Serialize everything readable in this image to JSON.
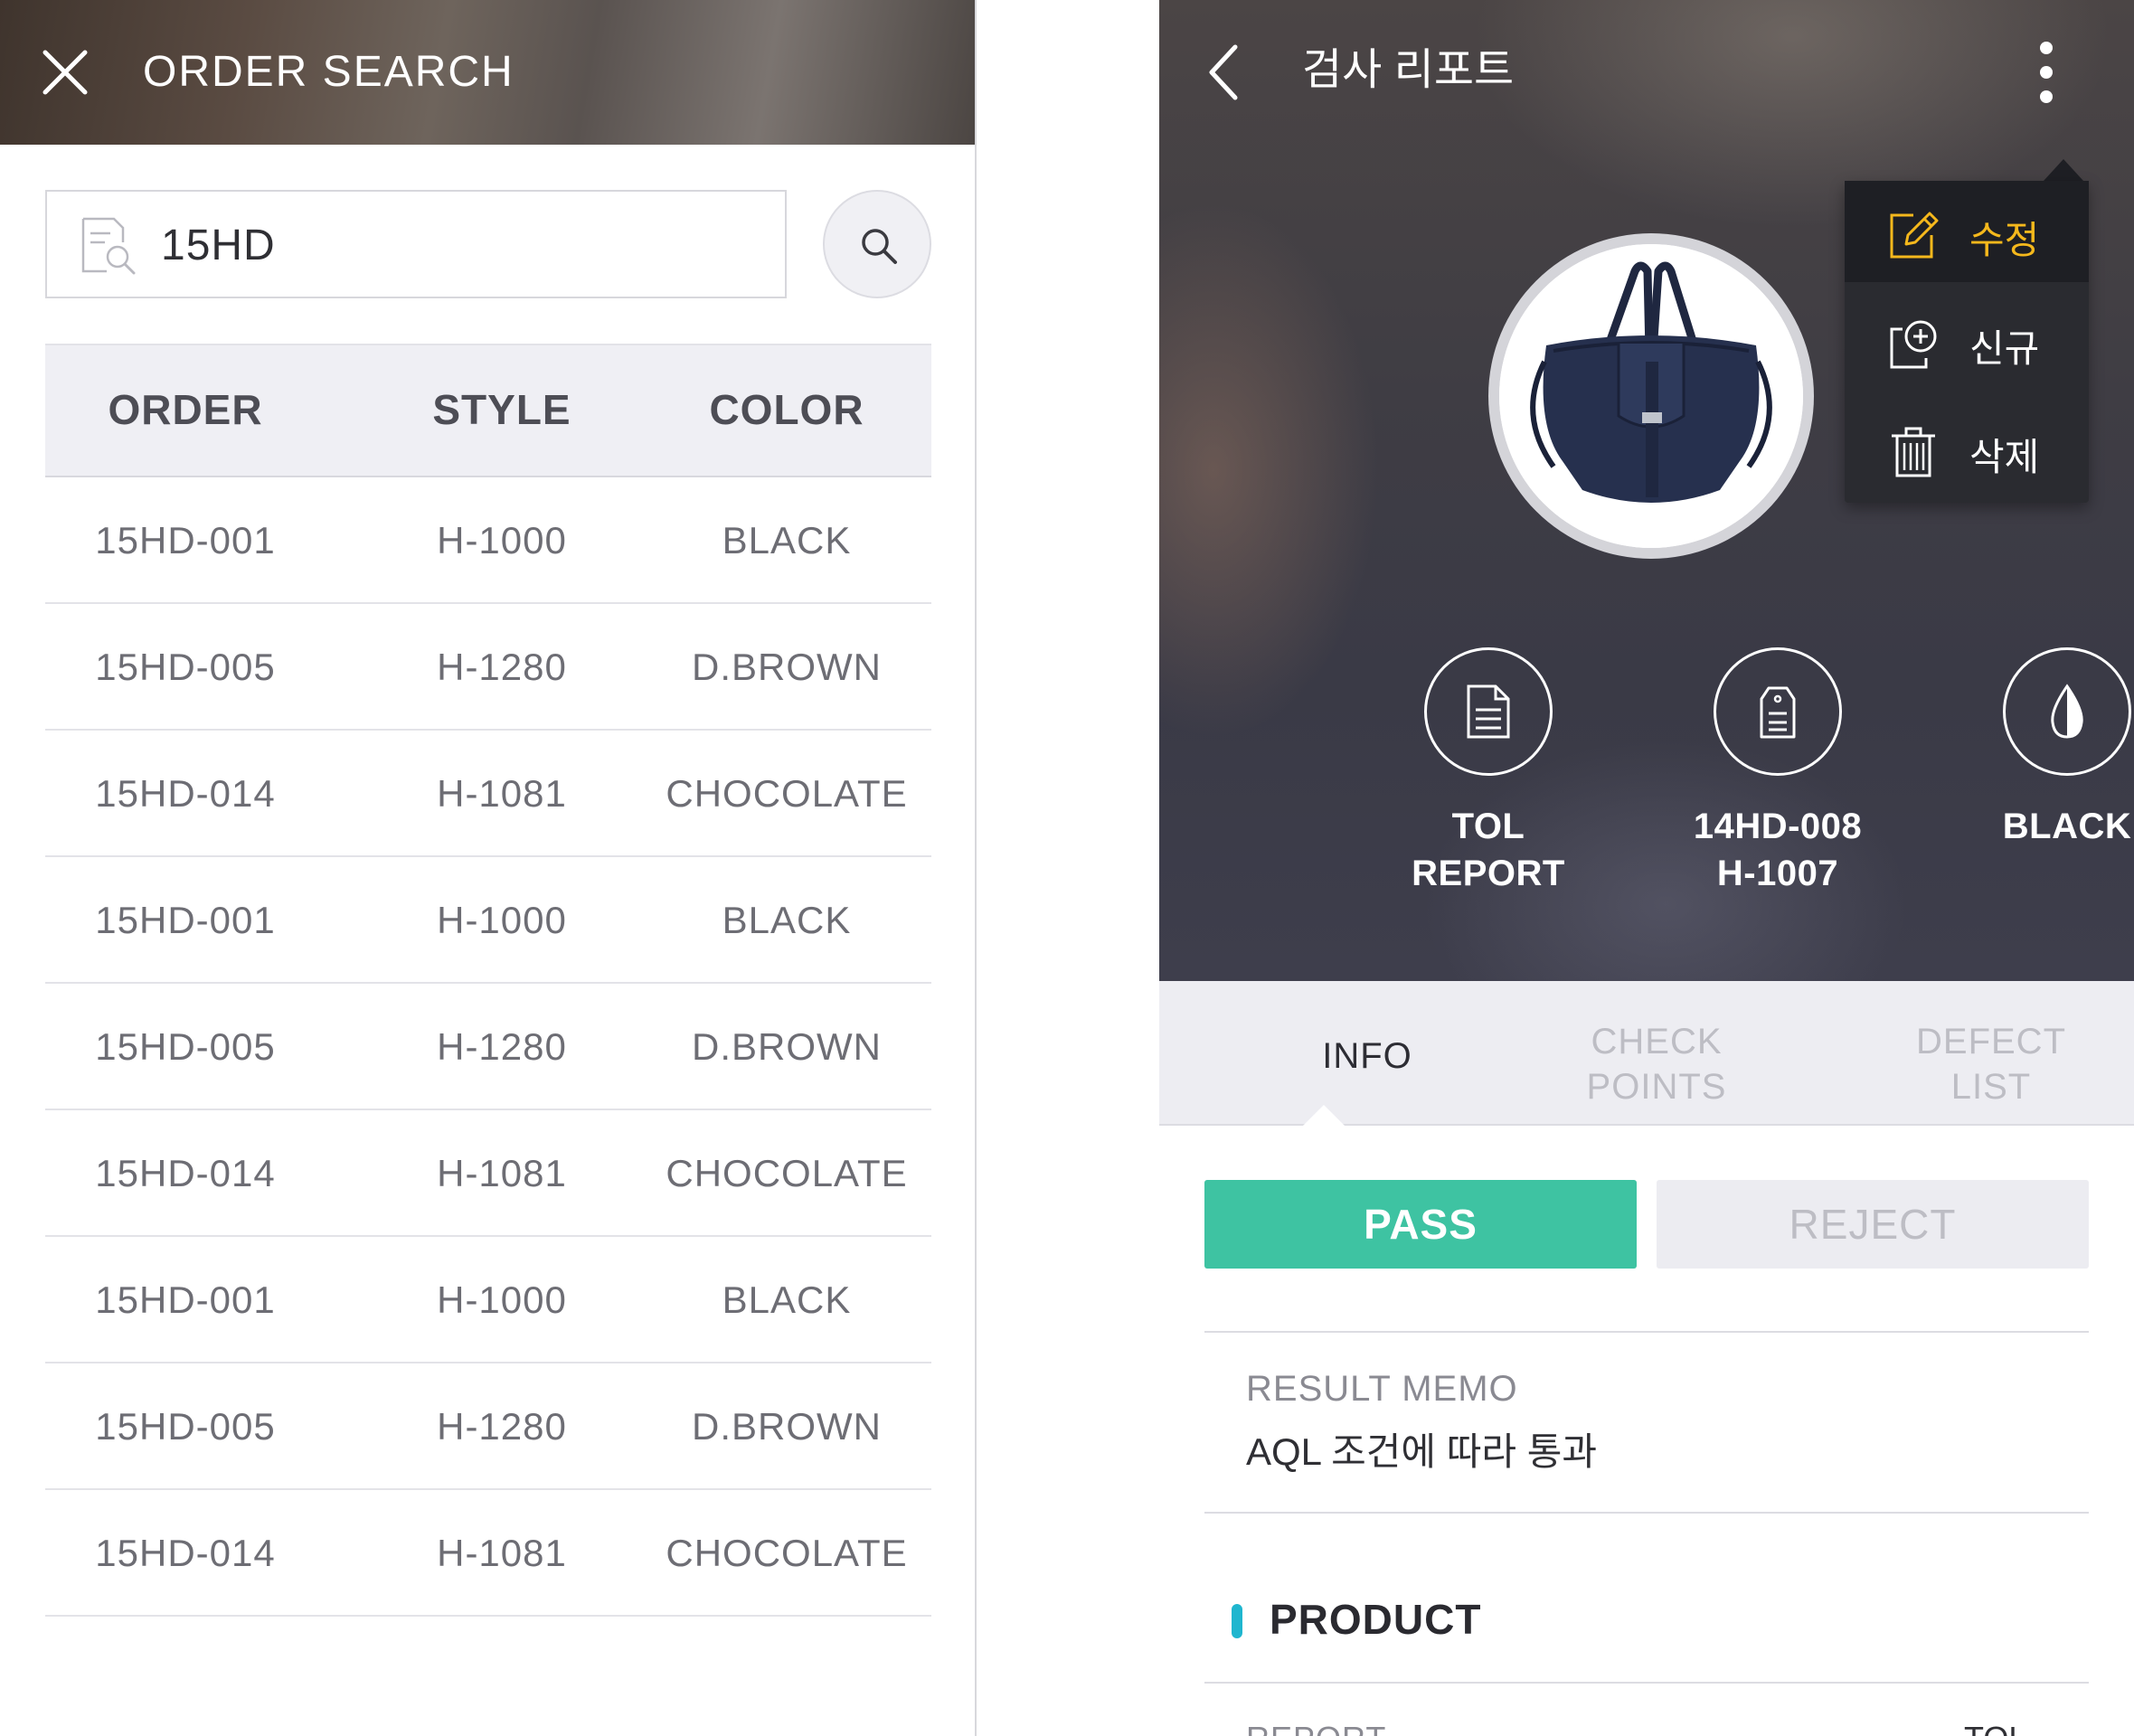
{
  "left": {
    "header": {
      "title": "ORDER SEARCH",
      "close_icon": "close-icon"
    },
    "search": {
      "value": "15HD",
      "placeholder": ""
    },
    "table": {
      "headers": [
        "ORDER",
        "STYLE",
        "COLOR"
      ],
      "rows": [
        [
          "15HD-001",
          "H-1000",
          "BLACK"
        ],
        [
          "15HD-005",
          "H-1280",
          "D.BROWN"
        ],
        [
          "15HD-014",
          "H-1081",
          "CHOCOLATE"
        ],
        [
          "15HD-001",
          "H-1000",
          "BLACK"
        ],
        [
          "15HD-005",
          "H-1280",
          "D.BROWN"
        ],
        [
          "15HD-014",
          "H-1081",
          "CHOCOLATE"
        ],
        [
          "15HD-001",
          "H-1000",
          "BLACK"
        ],
        [
          "15HD-005",
          "H-1280",
          "D.BROWN"
        ],
        [
          "15HD-014",
          "H-1081",
          "CHOCOLATE"
        ]
      ]
    }
  },
  "right": {
    "header": {
      "title": "검사 리포트"
    },
    "menu": {
      "items": [
        {
          "label": "수정",
          "icon": "edit-icon",
          "active": true
        },
        {
          "label": "신규",
          "icon": "new-document-icon",
          "active": false
        },
        {
          "label": "삭제",
          "icon": "trash-icon",
          "active": false
        }
      ]
    },
    "stats": [
      {
        "icon": "document-icon",
        "line1": "TOL",
        "line2": "REPORT"
      },
      {
        "icon": "tag-icon",
        "line1": "14HD-008",
        "line2": "H-1007"
      },
      {
        "icon": "drop-icon",
        "line1": "BLACK",
        "line2": ""
      }
    ],
    "tabs": [
      {
        "line1": "INFO",
        "line2": "",
        "active": true
      },
      {
        "line1": "CHECK",
        "line2": "POINTS",
        "active": false
      },
      {
        "line1": "DEFECT",
        "line2": "LIST",
        "active": false
      }
    ],
    "result": {
      "pass_label": "PASS",
      "reject_label": "REJECT",
      "selected": "PASS"
    },
    "memo": {
      "label": "RESULT MEMO",
      "value": "AQL 조건에 따라 통과"
    },
    "product": {
      "heading": "PRODUCT",
      "next_row_label": "REPORT",
      "next_row_value": "TOL"
    }
  },
  "colors": {
    "accent_pass": "#3ec3a2",
    "menu_active": "#f5b81c",
    "section_marker": "#1fb6cf"
  }
}
